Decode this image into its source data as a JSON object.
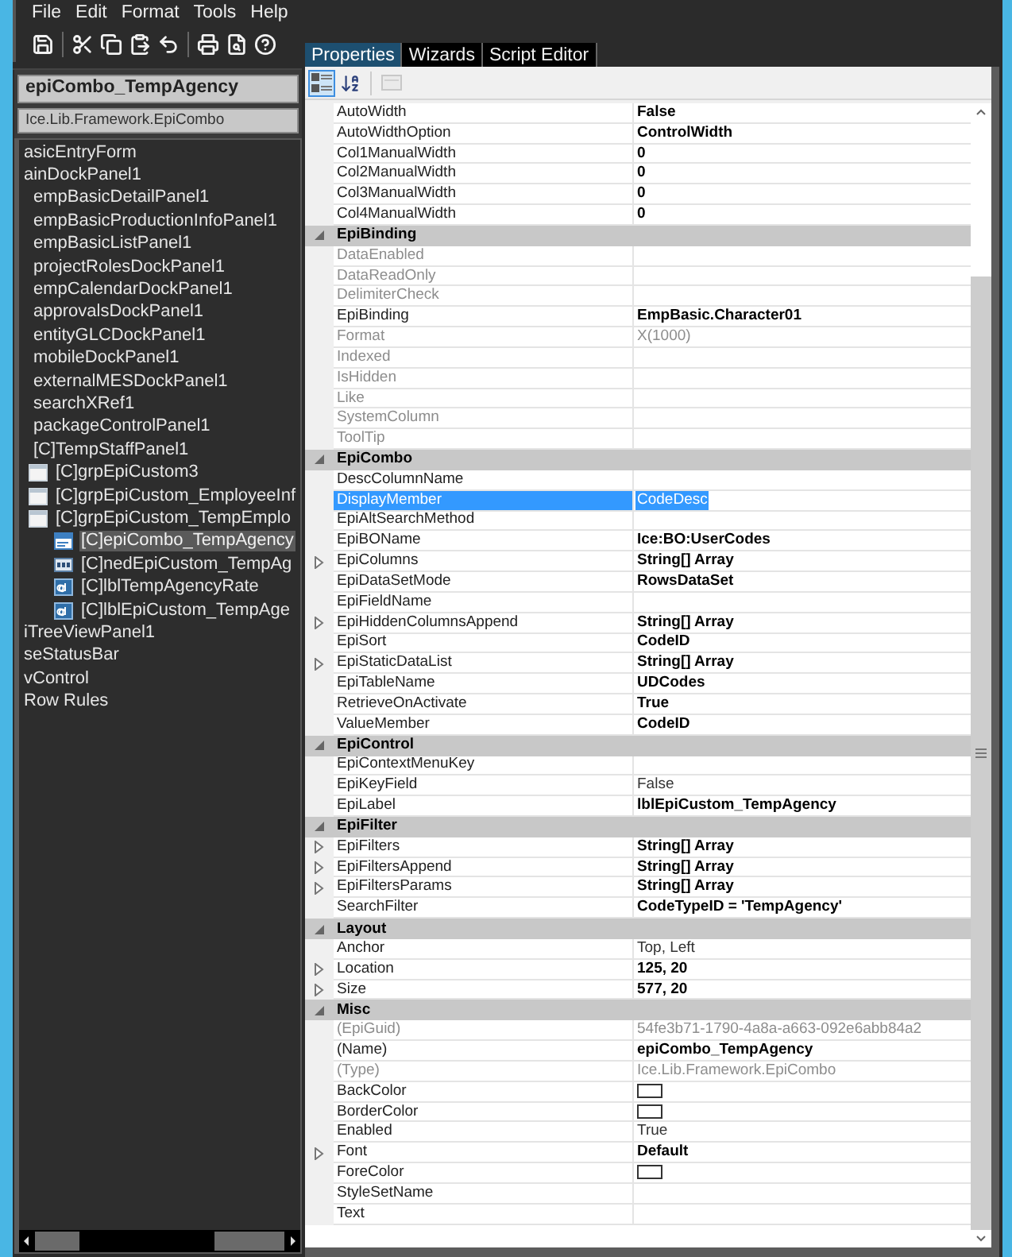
{
  "menu": [
    "File",
    "Edit",
    "Format",
    "Tools",
    "Help"
  ],
  "selection": {
    "name": "epiCombo_TempAgency",
    "type": "Ice.Lib.Framework.EpiCombo"
  },
  "tree": [
    {
      "label": "asicEntryForm",
      "selected": false
    },
    {
      "label": "ainDockPanel1",
      "selected": false,
      "children": [
        {
          "label": "empBasicDetailPanel1",
          "selected": false
        },
        {
          "label": "empBasicProductionInfoPanel1",
          "selected": false
        },
        {
          "label": "empBasicListPanel1",
          "selected": false
        },
        {
          "label": "projectRolesDockPanel1",
          "selected": false
        },
        {
          "label": "empCalendarDockPanel1",
          "selected": false
        },
        {
          "label": "approvalsDockPanel1",
          "selected": false
        },
        {
          "label": "entityGLCDockPanel1",
          "selected": false
        },
        {
          "label": "mobileDockPanel1",
          "selected": false
        },
        {
          "label": "externalMESDockPanel1",
          "selected": false
        },
        {
          "label": "searchXRef1",
          "selected": false
        },
        {
          "label": "packageControlPanel1",
          "selected": false
        },
        {
          "label": "[C]TempStaffPanel1",
          "selected": false,
          "children": [
            {
              "label": "[C]grpEpiCustom3",
              "kind": "group",
              "selected": false
            },
            {
              "label": "[C]grpEpiCustom_EmployeeInf",
              "kind": "group",
              "selected": false
            },
            {
              "label": "[C]grpEpiCustom_TempEmplo",
              "kind": "group",
              "selected": false,
              "children": [
                {
                  "label": "[C]epiCombo_TempAgency",
                  "kind": "combo",
                  "selected": true
                },
                {
                  "label": "[C]nedEpiCustom_TempAg",
                  "kind": "numeric",
                  "selected": false
                },
                {
                  "label": "[C]lblTempAgencyRate",
                  "kind": "label",
                  "selected": false
                },
                {
                  "label": "[C]lblEpiCustom_TempAge",
                  "kind": "label",
                  "selected": false
                }
              ]
            }
          ]
        }
      ]
    },
    {
      "label": "iTreeViewPanel1",
      "selected": false
    },
    {
      "label": "seStatusBar",
      "selected": false
    },
    {
      "label": "vControl",
      "selected": false
    },
    {
      "label": "Row Rules",
      "selected": false
    }
  ],
  "tabs": [
    {
      "label": "Properties",
      "selected": true
    },
    {
      "label": "Wizards",
      "selected": false
    },
    {
      "label": "Script Editor",
      "selected": false
    }
  ],
  "grid_toolbar": [
    {
      "kind": "categorized",
      "selected": true,
      "disabled": false
    },
    {
      "kind": "alphabetical",
      "selected": false,
      "disabled": false
    },
    {
      "kind": "pages",
      "selected": false,
      "disabled": true
    }
  ],
  "leading_rows": [
    {
      "name": "AutoWidth",
      "value": "False",
      "kind": "text",
      "disabled": false,
      "modified": true,
      "expandable": false,
      "selected": false
    },
    {
      "name": "AutoWidthOption",
      "value": "ControlWidth",
      "kind": "text",
      "disabled": false,
      "modified": true,
      "expandable": false,
      "selected": false
    },
    {
      "name": "Col1ManualWidth",
      "value": "0",
      "kind": "text",
      "disabled": false,
      "modified": true,
      "expandable": false,
      "selected": false
    },
    {
      "name": "Col2ManualWidth",
      "value": "0",
      "kind": "text",
      "disabled": false,
      "modified": true,
      "expandable": false,
      "selected": false
    },
    {
      "name": "Col3ManualWidth",
      "value": "0",
      "kind": "text",
      "disabled": false,
      "modified": true,
      "expandable": false,
      "selected": false
    },
    {
      "name": "Col4ManualWidth",
      "value": "0",
      "kind": "text",
      "disabled": false,
      "modified": true,
      "expandable": false,
      "selected": false
    }
  ],
  "groups": [
    {
      "name": "EpiBinding",
      "expanded": true,
      "rows": [
        {
          "name": "DataEnabled",
          "kind": "text",
          "disabled": true,
          "expandable": false,
          "selected": false
        },
        {
          "name": "DataReadOnly",
          "kind": "text",
          "disabled": true,
          "expandable": false,
          "selected": false
        },
        {
          "name": "DelimiterCheck",
          "kind": "text",
          "disabled": true,
          "expandable": false,
          "selected": false
        },
        {
          "name": "EpiBinding",
          "value": "EmpBasic.Character01",
          "kind": "text",
          "disabled": false,
          "modified": true,
          "expandable": false,
          "selected": false
        },
        {
          "name": "Format",
          "value": "X(1000)",
          "kind": "text",
          "disabled": true,
          "modified": false,
          "expandable": false,
          "selected": false
        },
        {
          "name": "Indexed",
          "kind": "text",
          "disabled": true,
          "expandable": false,
          "selected": false
        },
        {
          "name": "IsHidden",
          "kind": "text",
          "disabled": true,
          "expandable": false,
          "selected": false
        },
        {
          "name": "Like",
          "kind": "text",
          "disabled": true,
          "expandable": false,
          "selected": false
        },
        {
          "name": "SystemColumn",
          "kind": "text",
          "disabled": true,
          "expandable": false,
          "selected": false
        },
        {
          "name": "ToolTip",
          "kind": "text",
          "disabled": true,
          "expandable": false,
          "selected": false
        }
      ]
    },
    {
      "name": "EpiCombo",
      "expanded": true,
      "rows": [
        {
          "name": "DescColumnName",
          "kind": "text",
          "disabled": false,
          "expandable": false,
          "selected": false
        },
        {
          "name": "DisplayMember",
          "value": "CodeDesc",
          "kind": "text",
          "disabled": false,
          "modified": false,
          "expandable": false,
          "selected": true
        },
        {
          "name": "EpiAltSearchMethod",
          "kind": "text",
          "disabled": false,
          "expandable": false,
          "selected": false
        },
        {
          "name": "EpiBOName",
          "value": "Ice:BO:UserCodes",
          "kind": "text",
          "disabled": false,
          "modified": true,
          "expandable": false,
          "selected": false
        },
        {
          "name": "EpiColumns",
          "value": "String[] Array",
          "kind": "text",
          "disabled": false,
          "modified": true,
          "expandable": true,
          "selected": false
        },
        {
          "name": "EpiDataSetMode",
          "value": "RowsDataSet",
          "kind": "text",
          "disabled": false,
          "modified": true,
          "expandable": false,
          "selected": false
        },
        {
          "name": "EpiFieldName",
          "kind": "text",
          "disabled": false,
          "expandable": false,
          "selected": false
        },
        {
          "name": "EpiHiddenColumnsAppend",
          "value": "String[] Array",
          "kind": "text",
          "disabled": false,
          "modified": true,
          "expandable": true,
          "selected": false
        },
        {
          "name": "EpiSort",
          "value": "CodeID",
          "kind": "text",
          "disabled": false,
          "modified": true,
          "expandable": false,
          "selected": false
        },
        {
          "name": "EpiStaticDataList",
          "value": "String[] Array",
          "kind": "text",
          "disabled": false,
          "modified": true,
          "expandable": true,
          "selected": false
        },
        {
          "name": "EpiTableName",
          "value": "UDCodes",
          "kind": "text",
          "disabled": false,
          "modified": true,
          "expandable": false,
          "selected": false
        },
        {
          "name": "RetrieveOnActivate",
          "value": "True",
          "kind": "text",
          "disabled": false,
          "modified": true,
          "expandable": false,
          "selected": false
        },
        {
          "name": "ValueMember",
          "value": "CodeID",
          "kind": "text",
          "disabled": false,
          "modified": true,
          "expandable": false,
          "selected": false
        }
      ]
    },
    {
      "name": "EpiControl",
      "expanded": true,
      "rows": [
        {
          "name": "EpiContextMenuKey",
          "kind": "text",
          "disabled": false,
          "expandable": false,
          "selected": false
        },
        {
          "name": "EpiKeyField",
          "value": "False",
          "kind": "text",
          "disabled": false,
          "modified": false,
          "expandable": false,
          "selected": false
        },
        {
          "name": "EpiLabel",
          "value": "lblEpiCustom_TempAgency",
          "kind": "text",
          "disabled": false,
          "modified": true,
          "expandable": false,
          "selected": false
        }
      ]
    },
    {
      "name": "EpiFilter",
      "expanded": true,
      "rows": [
        {
          "name": "EpiFilters",
          "value": "String[] Array",
          "kind": "text",
          "disabled": false,
          "modified": true,
          "expandable": true,
          "selected": false
        },
        {
          "name": "EpiFiltersAppend",
          "value": "String[] Array",
          "kind": "text",
          "disabled": false,
          "modified": true,
          "expandable": true,
          "selected": false
        },
        {
          "name": "EpiFiltersParams",
          "value": "String[] Array",
          "kind": "text",
          "disabled": false,
          "modified": true,
          "expandable": true,
          "selected": false
        },
        {
          "name": "SearchFilter",
          "value": "CodeTypeID = 'TempAgency'",
          "kind": "text",
          "disabled": false,
          "modified": true,
          "expandable": false,
          "selected": false
        }
      ]
    },
    {
      "name": "Layout",
      "expanded": true,
      "rows": [
        {
          "name": "Anchor",
          "value": "Top, Left",
          "kind": "text",
          "disabled": false,
          "modified": false,
          "expandable": false,
          "selected": false
        },
        {
          "name": "Location",
          "value": "125, 20",
          "kind": "text",
          "disabled": false,
          "modified": true,
          "expandable": true,
          "selected": false
        },
        {
          "name": "Size",
          "value": "577, 20",
          "kind": "text",
          "disabled": false,
          "modified": true,
          "expandable": true,
          "selected": false
        }
      ]
    },
    {
      "name": "Misc",
      "expanded": true,
      "rows": [
        {
          "name": "(EpiGuid)",
          "value": "54fe3b71-1790-4a8a-a663-092e6abb84a2",
          "kind": "text",
          "disabled": true,
          "modified": false,
          "expandable": false,
          "selected": false
        },
        {
          "name": "(Name)",
          "value": "epiCombo_TempAgency",
          "kind": "text",
          "disabled": false,
          "modified": true,
          "expandable": false,
          "selected": false
        },
        {
          "name": "(Type)",
          "value": "Ice.Lib.Framework.EpiCombo",
          "kind": "text",
          "disabled": true,
          "modified": false,
          "expandable": false,
          "selected": false
        },
        {
          "name": "BackColor",
          "kind": "swatch",
          "disabled": false,
          "expandable": false,
          "selected": false
        },
        {
          "name": "BorderColor",
          "kind": "swatch",
          "disabled": false,
          "expandable": false,
          "selected": false
        },
        {
          "name": "Enabled",
          "value": "True",
          "kind": "text",
          "disabled": false,
          "modified": false,
          "expandable": false,
          "selected": false
        },
        {
          "name": "Font",
          "value": "Default",
          "kind": "text",
          "disabled": false,
          "modified": true,
          "expandable": true,
          "selected": false
        },
        {
          "name": "ForeColor",
          "kind": "swatch",
          "disabled": false,
          "expandable": false,
          "selected": false
        },
        {
          "name": "StyleSetName",
          "kind": "text",
          "disabled": false,
          "expandable": false,
          "selected": false
        },
        {
          "name": "Text",
          "kind": "text",
          "disabled": false,
          "expandable": false,
          "selected": false
        }
      ]
    }
  ]
}
